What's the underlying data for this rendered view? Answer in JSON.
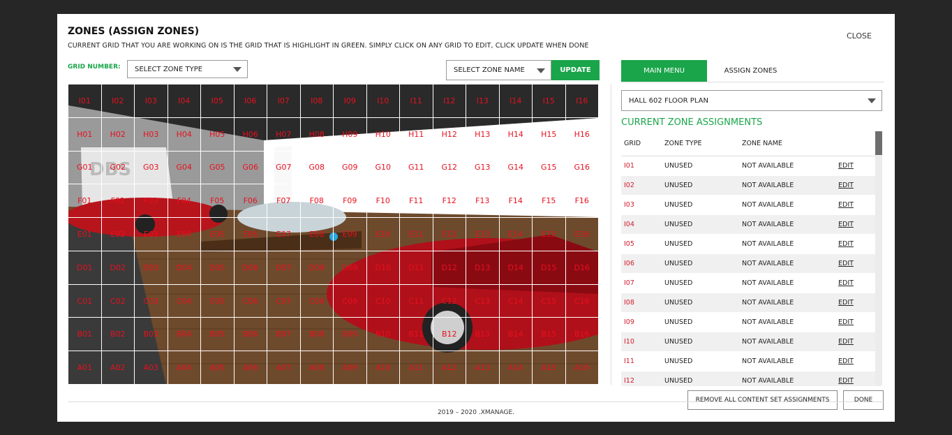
{
  "header": {
    "title": "ZONES (ASSIGN ZONES)",
    "subtitle": "CURRENT GRID THAT YOU ARE WORKING ON IS THE GRID THAT IS HIGHLIGHT IN GREEN. SIMPLY CLICK ON ANY GRID TO EDIT, CLICK UPDATE WHEN DONE",
    "close_label": "CLOSE"
  },
  "toolbar": {
    "grid_number_label": "GRID NUMBER:",
    "zone_type_select": "SELECT ZONE TYPE",
    "zone_name_select": "SELECT ZONE NAME",
    "update_label": "UPDATE"
  },
  "grid": {
    "rows": [
      "I",
      "H",
      "G",
      "F",
      "E",
      "D",
      "C",
      "B",
      "A"
    ],
    "columns": 16
  },
  "side": {
    "tabs": [
      "MAIN MENU",
      "ASSIGN ZONES"
    ],
    "active_tab": "MAIN MENU",
    "floor_plan": "HALL 602 FLOOR PLAN",
    "section_title": "CURRENT ZONE ASSIGNMENTS",
    "columns": [
      "GRID",
      "ZONE TYPE",
      "ZONE NAME"
    ],
    "rows": [
      {
        "grid": "I01",
        "type": "UNUSED",
        "name": "NOT AVAILABLE",
        "action": "EDIT"
      },
      {
        "grid": "I02",
        "type": "UNUSED",
        "name": "NOT AVAILABLE",
        "action": "EDIT"
      },
      {
        "grid": "I03",
        "type": "UNUSED",
        "name": "NOT AVAILABLE",
        "action": "EDIT"
      },
      {
        "grid": "I04",
        "type": "UNUSED",
        "name": "NOT AVAILABLE",
        "action": "EDIT"
      },
      {
        "grid": "I05",
        "type": "UNUSED",
        "name": "NOT AVAILABLE",
        "action": "EDIT"
      },
      {
        "grid": "I06",
        "type": "UNUSED",
        "name": "NOT AVAILABLE",
        "action": "EDIT"
      },
      {
        "grid": "I07",
        "type": "UNUSED",
        "name": "NOT AVAILABLE",
        "action": "EDIT"
      },
      {
        "grid": "I08",
        "type": "UNUSED",
        "name": "NOT AVAILABLE",
        "action": "EDIT"
      },
      {
        "grid": "I09",
        "type": "UNUSED",
        "name": "NOT AVAILABLE",
        "action": "EDIT"
      },
      {
        "grid": "I10",
        "type": "UNUSED",
        "name": "NOT AVAILABLE",
        "action": "EDIT"
      },
      {
        "grid": "I11",
        "type": "UNUSED",
        "name": "NOT AVAILABLE",
        "action": "EDIT"
      },
      {
        "grid": "I12",
        "type": "UNUSED",
        "name": "NOT AVAILABLE",
        "action": "EDIT"
      }
    ]
  },
  "footer": {
    "remove_label": "REMOVE ALL CONTENT SET ASSIGNMENTS",
    "done_label": "DONE",
    "copyright": "2019 – 2020 .XMANAGE."
  },
  "colors": {
    "accent": "#1aa54a",
    "grid_text": "#e8101e"
  }
}
